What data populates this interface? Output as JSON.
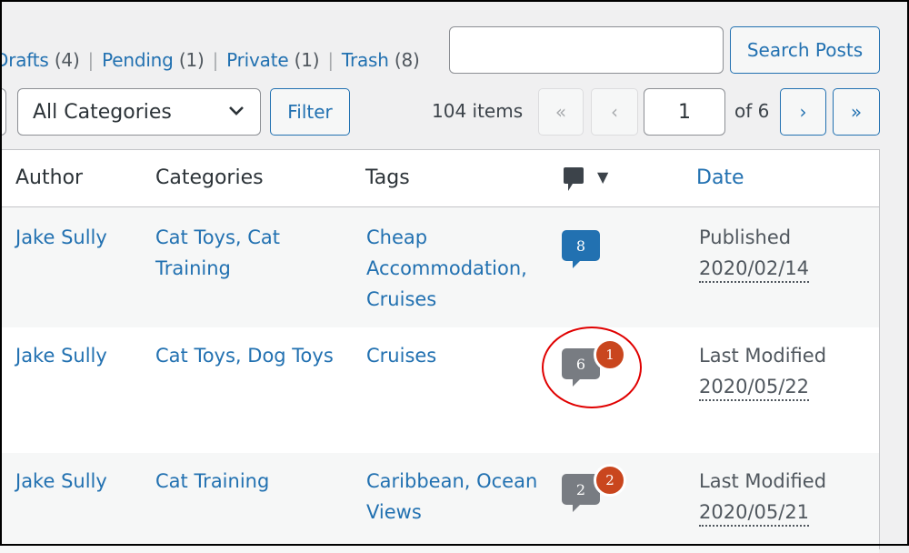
{
  "status_links": [
    {
      "label": "Drafts",
      "count": "(4)"
    },
    {
      "label": "Pending",
      "count": "(1)"
    },
    {
      "label": "Private",
      "count": "(1)"
    },
    {
      "label": "Trash",
      "count": "(8)"
    }
  ],
  "search": {
    "value": "",
    "button_label": "Search Posts"
  },
  "filters": {
    "category_selected": "All Categories",
    "filter_label": "Filter"
  },
  "pagination": {
    "items_count": "104 items",
    "first": "«",
    "prev": "‹",
    "current_page": "1",
    "of_pages": "of 6",
    "next": "›",
    "last": "»"
  },
  "table": {
    "headers": {
      "author": "Author",
      "categories": "Categories",
      "tags": "Tags",
      "comments_icon": "comment-icon",
      "sort_indicator": "▼",
      "date": "Date"
    },
    "rows": [
      {
        "author": "Jake Sully",
        "categories": [
          "Cat Toys, Cat",
          "Training"
        ],
        "tags": [
          "Cheap",
          "Accommodation,",
          "Cruises"
        ],
        "comments_approved": "8",
        "comments_pending": null,
        "date_status": "Published",
        "date": "2020/02/14"
      },
      {
        "author": "Jake Sully",
        "categories": [
          "Cat Toys, Dog Toys"
        ],
        "tags": [
          "Cruises"
        ],
        "comments_approved": "6",
        "comments_pending": "1",
        "date_status": "Last Modified",
        "date": "2020/05/22"
      },
      {
        "author": "Jake Sully",
        "categories": [
          "Cat Training"
        ],
        "tags": [
          "Caribbean, Ocean",
          "Views"
        ],
        "comments_approved": "2",
        "comments_pending": "2",
        "date_status": "Last Modified",
        "date": "2020/05/21"
      }
    ]
  },
  "colors": {
    "link": "#2271b1",
    "approved_bubble": "#2271b1",
    "gray_bubble": "#787c82",
    "pending_badge": "#c9461e",
    "annotation": "#e00000"
  }
}
